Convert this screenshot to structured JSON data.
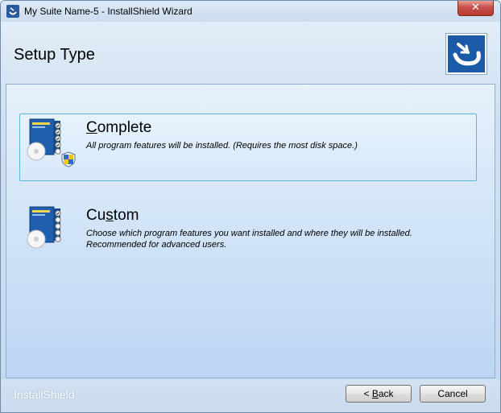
{
  "window": {
    "title": "My Suite Name-5 - InstallShield Wizard",
    "close_label": "✕"
  },
  "header": {
    "title": "Setup Type"
  },
  "options": [
    {
      "title_prefix": "",
      "title_accel": "C",
      "title_rest": "omplete",
      "description": "All program features will be installed. (Requires the most disk space.)",
      "selected": true
    },
    {
      "title_prefix": "Cu",
      "title_accel": "s",
      "title_rest": "tom",
      "description": "Choose which program features you want installed and where they will be installed. Recommended for advanced users.",
      "selected": false
    }
  ],
  "footer": {
    "brand": "InstallShield",
    "back_accel": "B",
    "back_rest": "ack",
    "back_prefix": "< ",
    "cancel_label": "Cancel"
  },
  "colors": {
    "selection_border": "#5fb6dd",
    "logo_blue": "#1a5aa6",
    "close_red": "#c75050"
  },
  "icons": {
    "app": "installshield-app-icon",
    "logo": "installshield-logo-icon",
    "option": "software-box-cd-icon",
    "uac": "uac-shield-icon"
  }
}
